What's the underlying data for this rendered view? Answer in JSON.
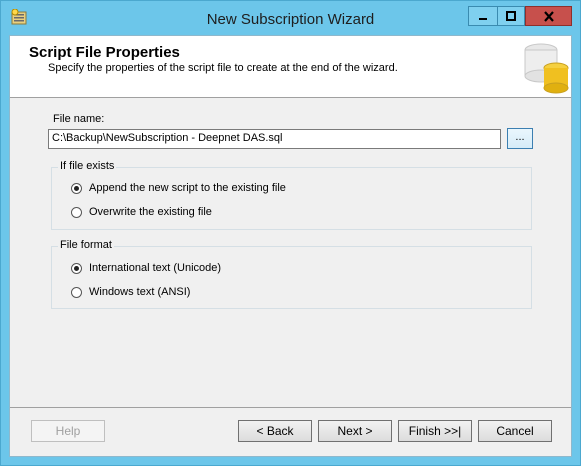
{
  "window": {
    "title": "New Subscription Wizard"
  },
  "header": {
    "title": "Script File Properties",
    "subtitle": "Specify the properties of the script file to create at the end of the wizard."
  },
  "file": {
    "label": "File name:",
    "value": "C:\\Backup\\NewSubscription - Deepnet DAS.sql",
    "browse_label": "..."
  },
  "if_exists": {
    "legend": "If file exists",
    "options": [
      {
        "label": "Append the new script to the existing file",
        "selected": true
      },
      {
        "label": "Overwrite the existing file",
        "selected": false
      }
    ]
  },
  "file_format": {
    "legend": "File format",
    "options": [
      {
        "label": "International text (Unicode)",
        "selected": true
      },
      {
        "label": "Windows text (ANSI)",
        "selected": false
      }
    ]
  },
  "buttons": {
    "help": "Help",
    "back": "< Back",
    "next": "Next >",
    "finish": "Finish >>|",
    "cancel": "Cancel"
  },
  "colors": {
    "titlebar": "#6cc6ea",
    "close": "#c7504c",
    "dialog_bg": "#f0f0f0"
  }
}
